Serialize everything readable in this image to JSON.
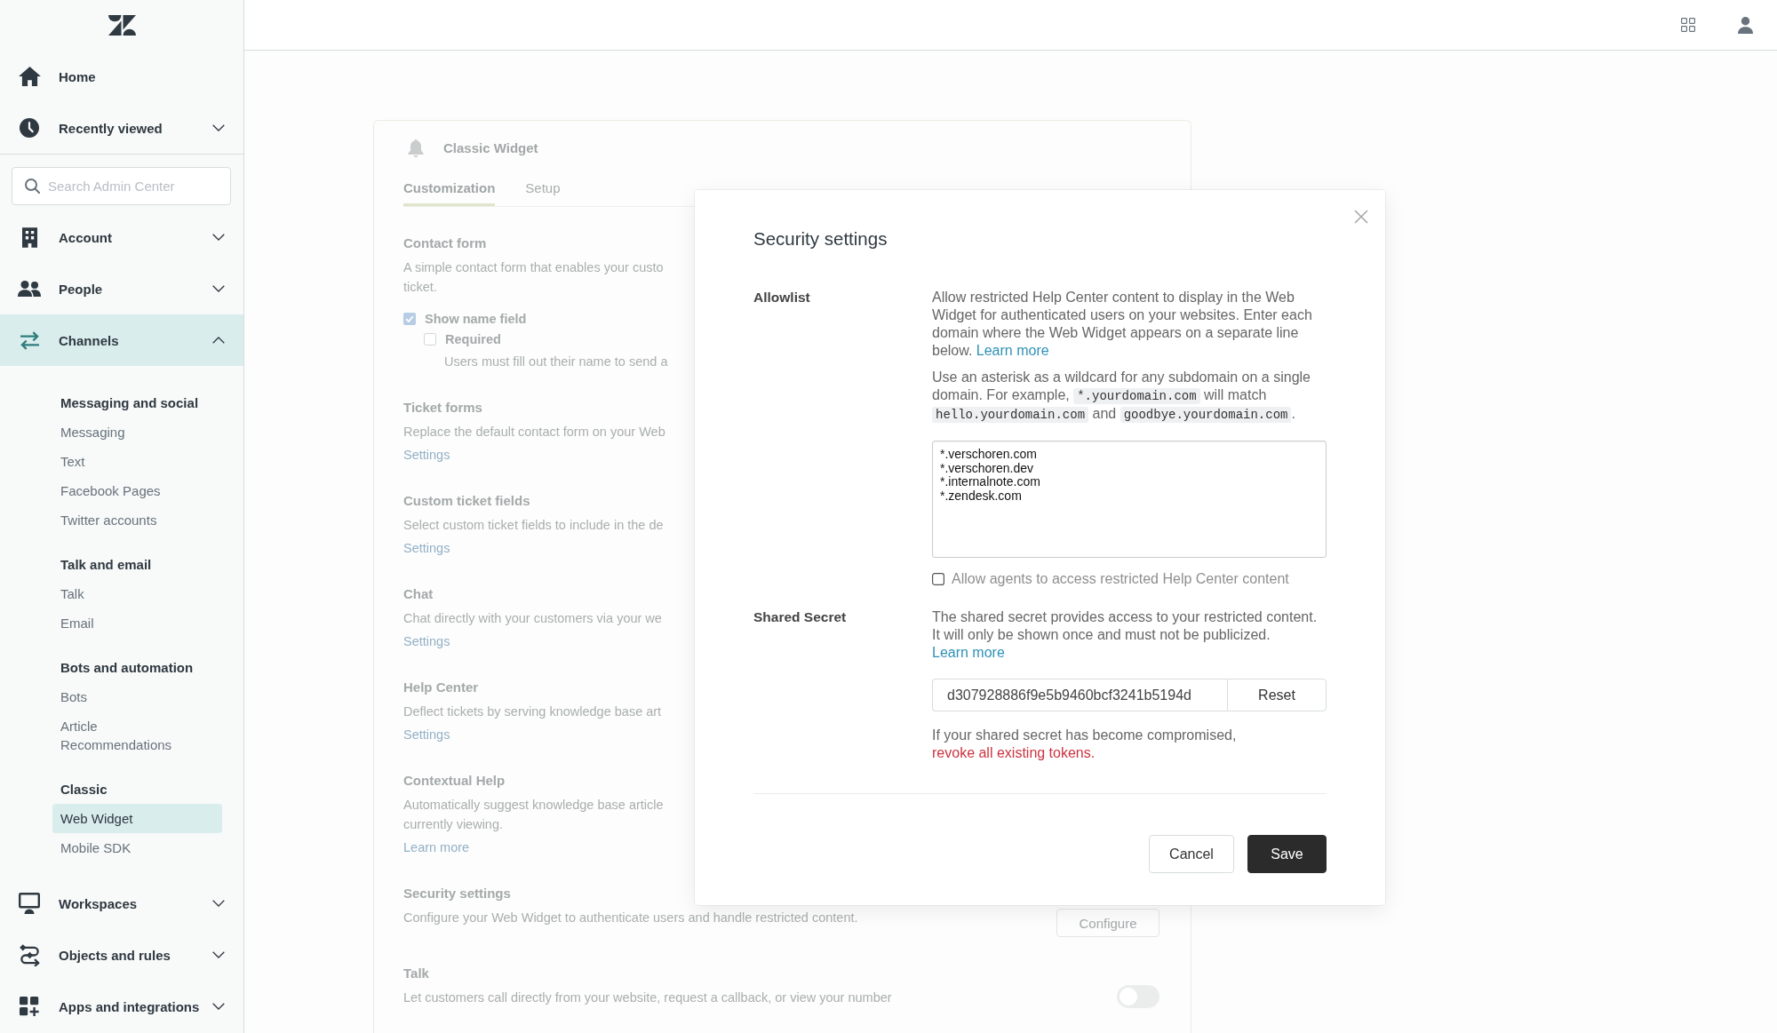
{
  "sidebar": {
    "home": {
      "label": "Home"
    },
    "recently_viewed": {
      "label": "Recently viewed",
      "expanded": false
    },
    "search": {
      "placeholder": "Search Admin Center"
    },
    "nav": [
      {
        "label": "Account",
        "expanded": false,
        "selected": false
      },
      {
        "label": "People",
        "expanded": false,
        "selected": false
      },
      {
        "label": "Channels",
        "expanded": true,
        "selected": true,
        "groups": [
          {
            "title": "Messaging and social",
            "items": [
              {
                "label": "Messaging",
                "selected": false
              },
              {
                "label": "Text",
                "selected": false
              },
              {
                "label": "Facebook Pages",
                "selected": false
              },
              {
                "label": "Twitter accounts",
                "selected": false
              }
            ]
          },
          {
            "title": "Talk and email",
            "items": [
              {
                "label": "Talk",
                "selected": false
              },
              {
                "label": "Email",
                "selected": false
              }
            ]
          },
          {
            "title": "Bots and automation",
            "items": [
              {
                "label": "Bots",
                "selected": false
              },
              {
                "label": "Article Recommendations",
                "selected": false
              }
            ]
          },
          {
            "title": "Classic",
            "items": [
              {
                "label": "Web Widget",
                "selected": true
              },
              {
                "label": "Mobile SDK",
                "selected": false
              }
            ]
          }
        ]
      },
      {
        "label": "Workspaces",
        "expanded": false,
        "selected": false
      },
      {
        "label": "Objects and rules",
        "expanded": false,
        "selected": false
      },
      {
        "label": "Apps and integrations",
        "expanded": false,
        "selected": false
      }
    ]
  },
  "page": {
    "title": "Classic Widget",
    "tabs": [
      {
        "label": "Customization",
        "selected": true
      },
      {
        "label": "Setup",
        "selected": false
      }
    ],
    "sections": [
      {
        "title": "Contact form",
        "description": [
          "A simple contact form that enables your custo",
          "ticket."
        ],
        "options": [
          {
            "label": "Show name field",
            "checked": true,
            "children": [
              {
                "label": "Required",
                "checked": false,
                "hint": "Users must fill out their name to send a"
              }
            ]
          }
        ]
      },
      {
        "title": "Ticket forms",
        "description": [
          "Replace the default contact form on your Web"
        ],
        "link": "Settings"
      },
      {
        "title": "Custom ticket fields",
        "description": [
          "Select custom ticket fields to include in the de"
        ],
        "link": "Settings"
      },
      {
        "title": "Chat",
        "description": [
          "Chat directly with your customers via your we"
        ],
        "link": "Settings"
      },
      {
        "title": "Help Center",
        "description": [
          "Deflect tickets by serving knowledge base art"
        ],
        "link": "Settings"
      },
      {
        "title": "Contextual Help",
        "description": [
          "Automatically suggest knowledge base article",
          "currently viewing."
        ],
        "link": "Learn more"
      },
      {
        "title": "Security settings",
        "description": [
          "Configure your Web Widget to authenticate users and handle restricted content."
        ],
        "button": "Configure"
      },
      {
        "title": "Talk",
        "description": [
          "Let customers call directly from your website, request a callback, or view your number"
        ],
        "toggle": {
          "on": false
        }
      }
    ]
  },
  "modal": {
    "title": "Security settings",
    "allowlist": {
      "label": "Allowlist",
      "intro": {
        "text": "Allow restricted Help Center content to display in the Web Widget for authenticated users on your websites. Enter each domain where the Web Widget appears on a separate line below.",
        "link": "Learn more"
      },
      "wildcard_hint": [
        {
          "kind": "text",
          "text": "Use an asterisk as a wildcard for any subdomain on a single domain. For example, "
        },
        {
          "kind": "code",
          "text": "*.yourdomain.com"
        },
        {
          "kind": "text",
          "text": " will match "
        },
        {
          "kind": "code",
          "text": "hello.yourdomain.com"
        },
        {
          "kind": "text",
          "text": " and "
        },
        {
          "kind": "code",
          "text": "goodbye.yourdomain.com"
        },
        {
          "kind": "text",
          "text": "."
        }
      ],
      "domains": [
        "*.verschoren.com",
        "*.verschoren.dev",
        "*.internalnote.com",
        "*.zendesk.com"
      ],
      "checkbox": {
        "label": "Allow agents to access restricted Help Center content",
        "checked": false
      }
    },
    "shared_secret": {
      "label": "Shared Secret",
      "intro": {
        "text": "The shared secret provides access to your restricted content. It will only be shown once and must not be publicized.",
        "link": "Learn more"
      },
      "value": "d307928886f9e5b9460bcf3241b5194d",
      "button": "Reset",
      "warning": {
        "text": "If your shared secret has become compromised,",
        "link": "revoke all existing tokens."
      }
    },
    "buttons": [
      {
        "label": "Cancel",
        "kind": "secondary"
      },
      {
        "label": "Save",
        "kind": "primary"
      }
    ]
  }
}
